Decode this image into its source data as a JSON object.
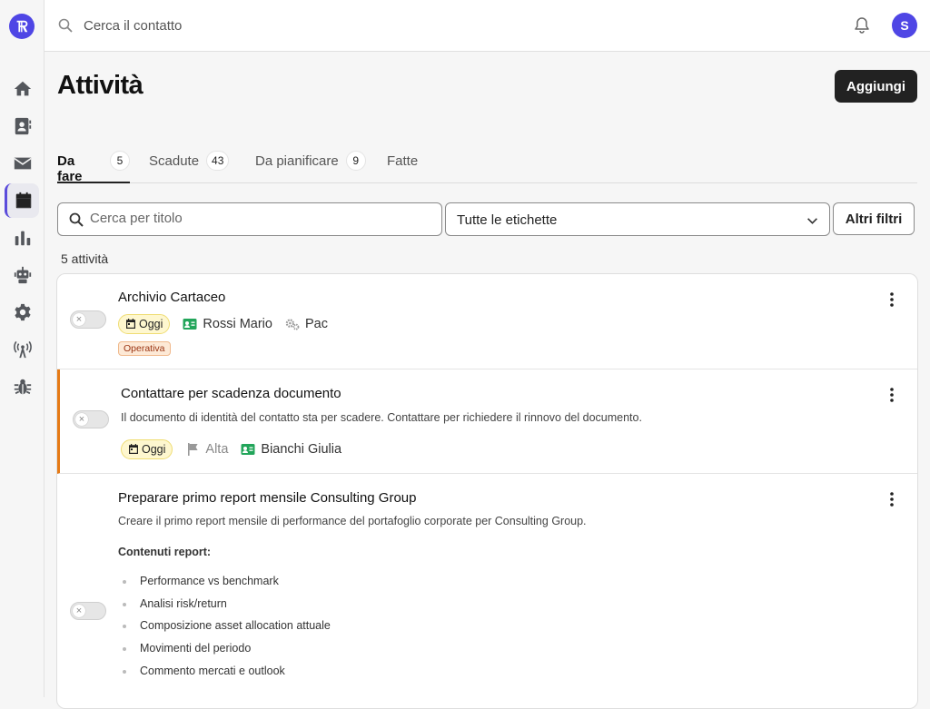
{
  "app": {
    "avatar_initial": "S"
  },
  "colors": {
    "brand": "#4f46e5",
    "priority_accent": "#e67a16",
    "contact_icon": "#22a55a",
    "today_chip_bg": "#fef7cf"
  },
  "sidebar": {
    "items": [
      {
        "name": "sidebar-item-home",
        "icon": "home-icon"
      },
      {
        "name": "sidebar-item-contacts",
        "icon": "contact-book-icon"
      },
      {
        "name": "sidebar-item-mail",
        "icon": "envelope-icon"
      },
      {
        "name": "sidebar-item-calendar",
        "icon": "calendar-icon",
        "active": true
      },
      {
        "name": "sidebar-item-reports",
        "icon": "bar-chart-icon"
      },
      {
        "name": "sidebar-item-automation",
        "icon": "robot-icon"
      },
      {
        "name": "sidebar-item-settings",
        "icon": "gear-icon"
      },
      {
        "name": "sidebar-item-broadcast",
        "icon": "antenna-icon"
      },
      {
        "name": "sidebar-item-debug",
        "icon": "bug-icon"
      }
    ]
  },
  "topbar": {
    "search_placeholder": "Cerca il contatto"
  },
  "page": {
    "title": "Attività",
    "add_label": "Aggiungi"
  },
  "tabs": [
    {
      "label": "Da fare",
      "count": "5",
      "active": true
    },
    {
      "label": "Scadute",
      "count": "43"
    },
    {
      "label": "Da pianificare",
      "count": "9"
    },
    {
      "label": "Fatte"
    }
  ],
  "filters": {
    "search_placeholder": "Cerca per titolo",
    "labels_value": "Tutte le etichette",
    "more_filters_label": "Altri filtri"
  },
  "list": {
    "count_label": "5 attività",
    "tasks": [
      {
        "title": "Archivio Cartaceo",
        "due": "Oggi",
        "contact": "Rossi Mario",
        "assignee": "Pac",
        "tag": "Operativa"
      },
      {
        "title": "Contattare per scadenza documento",
        "description": "Il documento di identità del contatto sta per scadere. Contattare per richiedere il rinnovo del documento.",
        "due": "Oggi",
        "priority": "Alta",
        "contact": "Bianchi Giulia"
      },
      {
        "title": "Preparare primo report mensile Consulting Group",
        "description": "Creare il primo report mensile di performance del portafoglio corporate per Consulting Group.",
        "subheading": "Contenuti report:",
        "bullets": [
          "Performance vs benchmark",
          "Analisi risk/return",
          "Composizione asset allocation attuale",
          "Movimenti del periodo",
          "Commento mercati e outlook"
        ]
      }
    ]
  }
}
